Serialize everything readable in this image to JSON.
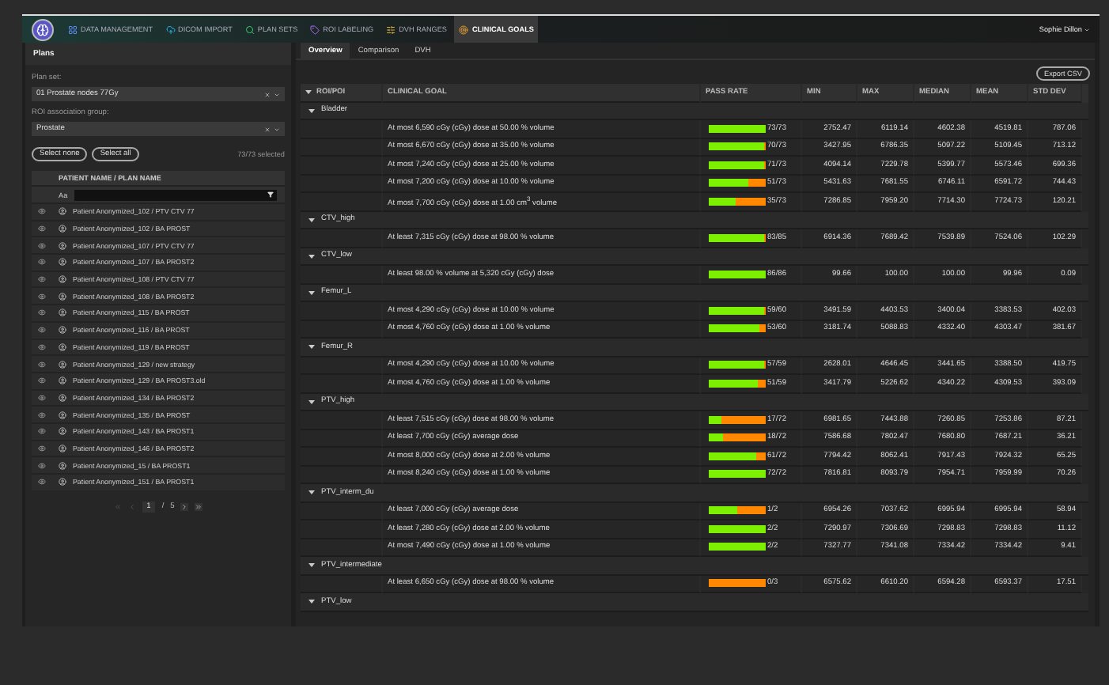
{
  "nav": {
    "items": [
      {
        "label": "DATA MANAGEMENT",
        "kind": "grid",
        "selected": false
      },
      {
        "label": "DICOM IMPORT",
        "kind": "cloud",
        "selected": false
      },
      {
        "label": "PLAN SETS",
        "kind": "search",
        "selected": false
      },
      {
        "label": "ROI LABELING",
        "kind": "labels",
        "selected": false
      },
      {
        "label": "DVH RANGES",
        "kind": "ranges",
        "selected": false
      },
      {
        "label": "CLINICAL GOALS",
        "kind": "goals",
        "selected": true
      }
    ],
    "user": "Sophie Dillon"
  },
  "plans_panel": {
    "title": "Plans",
    "plan_set_label": "Plan set:",
    "plan_set": "01 Prostate nodes 77Gy",
    "roi_group_label": "ROI association group:",
    "roi_group": "Prostate",
    "buttons": [
      "Select none",
      "Select all"
    ],
    "selected_count": "73/73 selected",
    "column": "PATIENT NAME / PLAN NAME",
    "filter_prefix": "Aa",
    "rows": [
      "Patient Anonymized_102 / PTV CTV 77",
      "Patient Anonymized_102 / BA PROST",
      "Patient Anonymized_107 / PTV CTV 77",
      "Patient Anonymized_107 / BA PROST2",
      "Patient Anonymized_108 / PTV CTV 77",
      "Patient Anonymized_108 / BA PROST2",
      "Patient Anonymized_115 / BA PROST",
      "Patient Anonymized_116 / BA PROST",
      "Patient Anonymized_119 / BA PROST",
      "Patient Anonymized_129 / new strategy",
      "Patient Anonymized_129 / BA PROST3.old",
      "Patient Anonymized_134 / BA PROST2",
      "Patient Anonymized_135 / BA PROST",
      "Patient Anonymized_143 / BA PROST1",
      "Patient Anonymized_146 / BA PROST2",
      "Patient Anonymized_15 / BA PROST1",
      "Patient Anonymized_151 / BA PROST1"
    ],
    "page": "1",
    "page_sep": "/",
    "pages": "5"
  },
  "main": {
    "tabs": [
      {
        "label": "Overview",
        "selected": true
      },
      {
        "label": "Comparison",
        "selected": false
      },
      {
        "label": "DVH",
        "selected": false
      }
    ],
    "export": "Export CSV",
    "columns": [
      "ROI/POI",
      "CLINICAL GOAL",
      "PASS RATE",
      "MIN",
      "MAX",
      "MEDIAN",
      "MEAN",
      "STD DEV"
    ],
    "groups": [
      {
        "roi": "Bladder",
        "expanded": true,
        "goals": [
          {
            "goal": "At most 6,590 cGy (cGy) dose at 50.00 % volume",
            "level": 1,
            "pass": "73/73",
            "min": "2752.47",
            "max": "6119.14",
            "median": "4602.38",
            "mean": "4519.81",
            "std": "787.06"
          },
          {
            "goal": "At most 6,670 cGy (cGy) dose at 35.00 % volume",
            "level": 0.959,
            "pass": "70/73",
            "min": "3427.95",
            "max": "6786.35",
            "median": "5097.22",
            "mean": "5109.45",
            "std": "713.12"
          },
          {
            "goal": "At most 7,240 cGy (cGy) dose at 25.00 % volume",
            "level": 0.973,
            "pass": "71/73",
            "min": "4094.14",
            "max": "7229.78",
            "median": "5399.77",
            "mean": "5573.46",
            "std": "699.36"
          },
          {
            "goal": "At most 7,200 cGy (cGy) dose at 10.00 % volume",
            "level": 0.699,
            "pass": "51/73",
            "min": "5431.63",
            "max": "7681.55",
            "median": "6746.11",
            "mean": "6591.72",
            "std": "744.43"
          },
          {
            "goal": "At most 7,700 cGy (cGy) dose at 1.00 cm$^{3}$ volume",
            "level": 0.479,
            "pass": "35/73",
            "min": "7286.85",
            "max": "7959.20",
            "median": "7714.30",
            "mean": "7724.73",
            "std": "120.21"
          }
        ]
      },
      {
        "roi": "CTV_high",
        "expanded": true,
        "goals": [
          {
            "goal": "At least 7,315 cGy (cGy) dose at 98.00 % volume",
            "level": 0.976,
            "pass": "83/85",
            "min": "6914.36",
            "max": "7689.42",
            "median": "7539.89",
            "mean": "7524.06",
            "std": "102.29"
          }
        ]
      },
      {
        "roi": "CTV_low",
        "expanded": true,
        "goals": [
          {
            "goal": "At least 98.00 % volume at 5,320 cGy (cGy) dose",
            "level": 1,
            "pass": "86/86",
            "min": "99.66",
            "max": "100.00",
            "median": "100.00",
            "mean": "99.96",
            "std": "0.09"
          }
        ]
      },
      {
        "roi": "Femur_L",
        "expanded": true,
        "goals": [
          {
            "goal": "At most 4,290 cGy (cGy) dose at 10.00 % volume",
            "level": 0.983,
            "pass": "59/60",
            "min": "3491.59",
            "max": "4403.53",
            "median": "3400.04",
            "mean": "3383.53",
            "std": "402.03"
          },
          {
            "goal": "At most 4,760 cGy (cGy) dose at 1.00 % volume",
            "level": 0.883,
            "pass": "53/60",
            "min": "3181.74",
            "max": "5088.83",
            "median": "4332.40",
            "mean": "4303.47",
            "std": "381.67"
          }
        ]
      },
      {
        "roi": "Femur_R",
        "expanded": true,
        "goals": [
          {
            "goal": "At most 4,290 cGy (cGy) dose at 10.00 % volume",
            "level": 0.966,
            "pass": "57/59",
            "min": "2628.01",
            "max": "4646.45",
            "median": "3441.65",
            "mean": "3388.50",
            "std": "419.75"
          },
          {
            "goal": "At most 4,760 cGy (cGy) dose at 1.00 % volume",
            "level": 0.864,
            "pass": "51/59",
            "min": "3417.79",
            "max": "5226.62",
            "median": "4340.22",
            "mean": "4309.53",
            "std": "393.09"
          }
        ]
      },
      {
        "roi": "PTV_high",
        "expanded": true,
        "goals": [
          {
            "goal": "At least 7,515 cGy (cGy) dose at 98.00 % volume",
            "level": 0.236,
            "pass": "17/72",
            "min": "6981.65",
            "max": "7443.88",
            "median": "7260.85",
            "mean": "7253.86",
            "std": "87.21"
          },
          {
            "goal": "At least 7,700 cGy (cGy) average dose",
            "level": 0.25,
            "pass": "18/72",
            "min": "7586.68",
            "max": "7802.47",
            "median": "7680.80",
            "mean": "7687.21",
            "std": "36.21"
          },
          {
            "goal": "At most 8,000 cGy (cGy) dose at 2.00 % volume",
            "level": 0.847,
            "pass": "61/72",
            "min": "7794.42",
            "max": "8062.41",
            "median": "7917.43",
            "mean": "7924.32",
            "std": "65.25"
          },
          {
            "goal": "At most 8,240 cGy (cGy) dose at 1.00 % volume",
            "level": 1,
            "pass": "72/72",
            "min": "7816.81",
            "max": "8093.79",
            "median": "7954.71",
            "mean": "7959.99",
            "std": "70.26"
          }
        ]
      },
      {
        "roi": "PTV_interm_du",
        "expanded": true,
        "goals": [
          {
            "goal": "At least 7,000 cGy (cGy) average dose",
            "level": 0.5,
            "pass": "1/2",
            "min": "6954.26",
            "max": "7037.62",
            "median": "6995.94",
            "mean": "6995.94",
            "std": "58.94"
          },
          {
            "goal": "At least 7,280 cGy (cGy) dose at 2.00 % volume",
            "level": 1,
            "pass": "2/2",
            "min": "7290.97",
            "max": "7306.69",
            "median": "7298.83",
            "mean": "7298.83",
            "std": "11.12"
          },
          {
            "goal": "At most 7,490 cGy (cGy) dose at 1.00 % volume",
            "level": 1,
            "pass": "2/2",
            "min": "7327.77",
            "max": "7341.08",
            "median": "7334.42",
            "mean": "7334.42",
            "std": "9.41"
          }
        ]
      },
      {
        "roi": "PTV_intermediate",
        "expanded": true,
        "goals": [
          {
            "goal": "At least 6,650 cGy (cGy) dose at 98.00 % volume",
            "level": 0,
            "pass": "0/3",
            "min": "6575.62",
            "max": "6610.20",
            "median": "6594.28",
            "mean": "6593.37",
            "std": "17.51"
          }
        ]
      },
      {
        "roi": "PTV_low",
        "expanded": true
      }
    ]
  }
}
